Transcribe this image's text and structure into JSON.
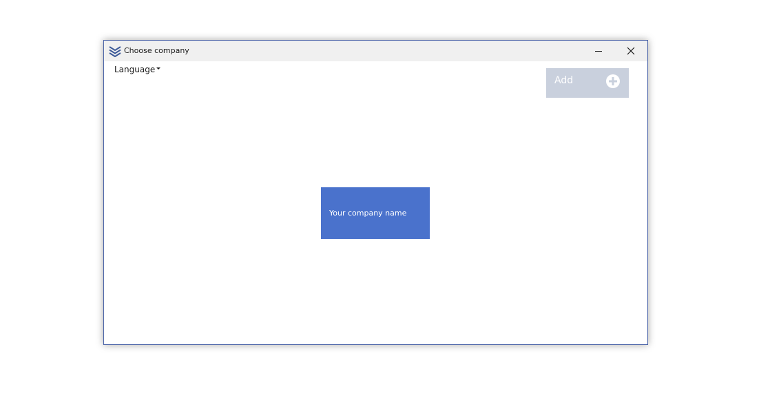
{
  "window": {
    "title": "Choose company",
    "app_icon": "layers-icon",
    "controls": {
      "minimize_icon": "minimize-icon",
      "close_icon": "close-icon"
    }
  },
  "menu": {
    "language_label": "Language",
    "language_caret_icon": "caret-down-icon"
  },
  "toolbar": {
    "add_label": "Add",
    "add_icon": "plus-circle-icon"
  },
  "companies": [
    {
      "name": "Your company name"
    }
  ],
  "colors": {
    "window_border": "#4a63a8",
    "titlebar_bg": "#f0f0f0",
    "add_button_bg": "#c9d0dd",
    "company_tile_bg": "#4a72cc"
  }
}
